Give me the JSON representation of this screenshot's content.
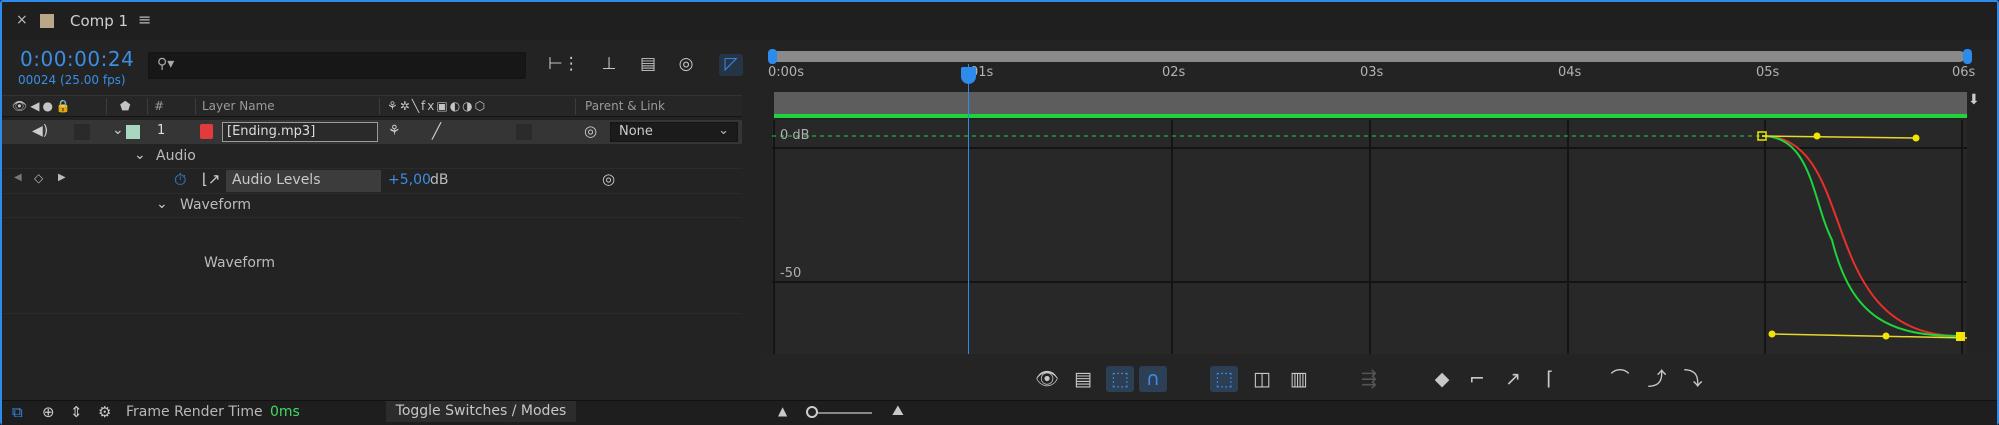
{
  "tab": {
    "close": "×",
    "title": "Comp 1",
    "menu": "≡"
  },
  "timecode": {
    "current": "0:00:00:24",
    "frames": "00024 (25.00 fps)"
  },
  "search": {
    "icon": "⚲▾"
  },
  "columns": {
    "hash": "#",
    "layer_name": "Layer Name",
    "switches": "⚘✲╲fx▣◐◑⬡",
    "parent": "Parent & Link"
  },
  "layer": {
    "index": "1",
    "name": "[Ending.mp3]",
    "parent": "None"
  },
  "tree": {
    "audio": "Audio",
    "audio_levels": "Audio Levels",
    "audio_levels_value": "+5,00",
    "audio_levels_unit": "dB",
    "waveform": "Waveform",
    "waveform_label": "Waveform"
  },
  "ruler": [
    "0:00s",
    "01s",
    "02s",
    "03s",
    "04s",
    "05s",
    "06s"
  ],
  "graph": {
    "label_top": "0 dB",
    "label_mid": "-50"
  },
  "footer": {
    "frame_render_label": "Frame Render Time",
    "frame_render_value": "0ms",
    "toggle": "Toggle Switches / Modes"
  },
  "colors": {
    "accent": "#2d8ceb",
    "green": "#1ed43b",
    "red_curve": "#e8302a",
    "yellow": "#f2e500"
  }
}
